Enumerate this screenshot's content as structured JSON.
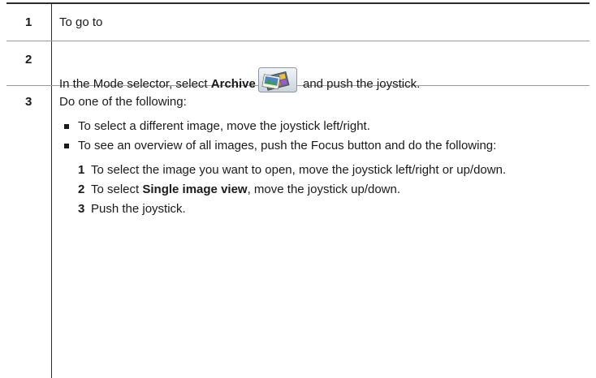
{
  "steps": [
    {
      "number": "1",
      "text": "To go to"
    },
    {
      "number": "2",
      "before": "In the Mode selector, select ",
      "bold": "Archive",
      "icon": "archive-mode-icon",
      "after": " and push the joystick."
    },
    {
      "number": "3",
      "intro": "Do one of the following:",
      "bullets": [
        "To select a different image, move the joystick left/right.",
        "To see an overview of all images, push the Focus button and do the following:"
      ],
      "substeps": [
        {
          "number": "1",
          "text": "To select the image you want to open, move the joystick left/right or up/down."
        },
        {
          "number": "2",
          "before": "To select ",
          "bold": "Single image view",
          "after": ", move the joystick up/down."
        },
        {
          "number": "3",
          "text": "Push the joystick."
        }
      ]
    }
  ],
  "colors": {
    "text": "#1a1a1a",
    "rule_dark": "#2b2b2b",
    "rule_light": "#9a9a9a"
  }
}
